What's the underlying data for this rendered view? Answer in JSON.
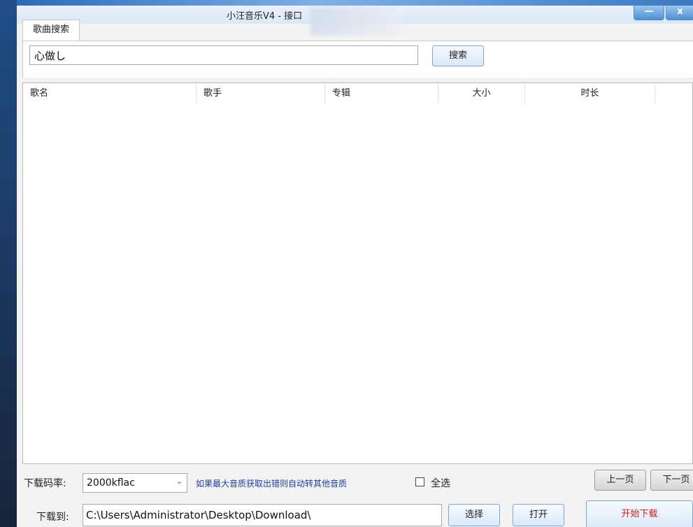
{
  "window": {
    "title": "小汪音乐V4 - 接口",
    "minimize_glyph": "—",
    "close_glyph": "x"
  },
  "tabs": [
    {
      "label": "歌曲搜索"
    }
  ],
  "search": {
    "query": "心做し",
    "button_label": "搜索"
  },
  "table": {
    "columns": [
      "歌名",
      "歌手",
      "专辑",
      "大小",
      "时长"
    ],
    "rows": []
  },
  "bitrate": {
    "label": "下载码率:",
    "selected": "2000kflac",
    "hint": "如果最大音质获取出错则自动转其他音质"
  },
  "select_all": {
    "label": "全选",
    "checked": false
  },
  "pager": {
    "prev_label": "上一页",
    "next_label": "下一页"
  },
  "download": {
    "label": "下载到:",
    "path": "C:\\Users\\Administrator\\Desktop\\Download\\",
    "choose_label": "选择",
    "open_label": "打开",
    "start_label": "开始下载"
  }
}
